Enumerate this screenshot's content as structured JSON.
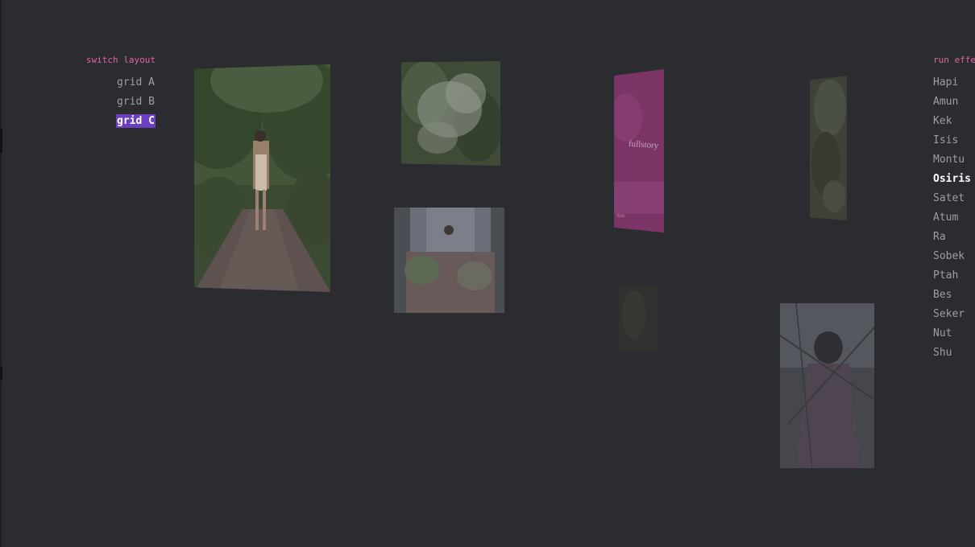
{
  "switch_layout": {
    "title": "switch layout",
    "items": [
      {
        "label": "grid A"
      },
      {
        "label": "grid B"
      },
      {
        "label": "grid C"
      }
    ],
    "active_item": "grid C"
  },
  "run_effect": {
    "title": "run effe",
    "items": [
      {
        "label": "Hapi"
      },
      {
        "label": "Amun"
      },
      {
        "label": "Kek"
      },
      {
        "label": "Isis"
      },
      {
        "label": "Montu"
      },
      {
        "label": "Osiris"
      },
      {
        "label": "Satet"
      },
      {
        "label": "Atum"
      },
      {
        "label": "Ra"
      },
      {
        "label": "Sobek"
      },
      {
        "label": "Ptah"
      },
      {
        "label": "Bes"
      },
      {
        "label": "Seker"
      },
      {
        "label": "Nut"
      },
      {
        "label": "Shu"
      }
    ],
    "active_item": "Osiris"
  },
  "gallery": {
    "book_cover_text": "fullstory",
    "book_cover_footer": "Sue"
  },
  "colors": {
    "background": "#2b2c30",
    "accent_pink": "#e0659f",
    "active_highlight": "#6b3fc0",
    "menu_text": "#9c9ea5"
  }
}
